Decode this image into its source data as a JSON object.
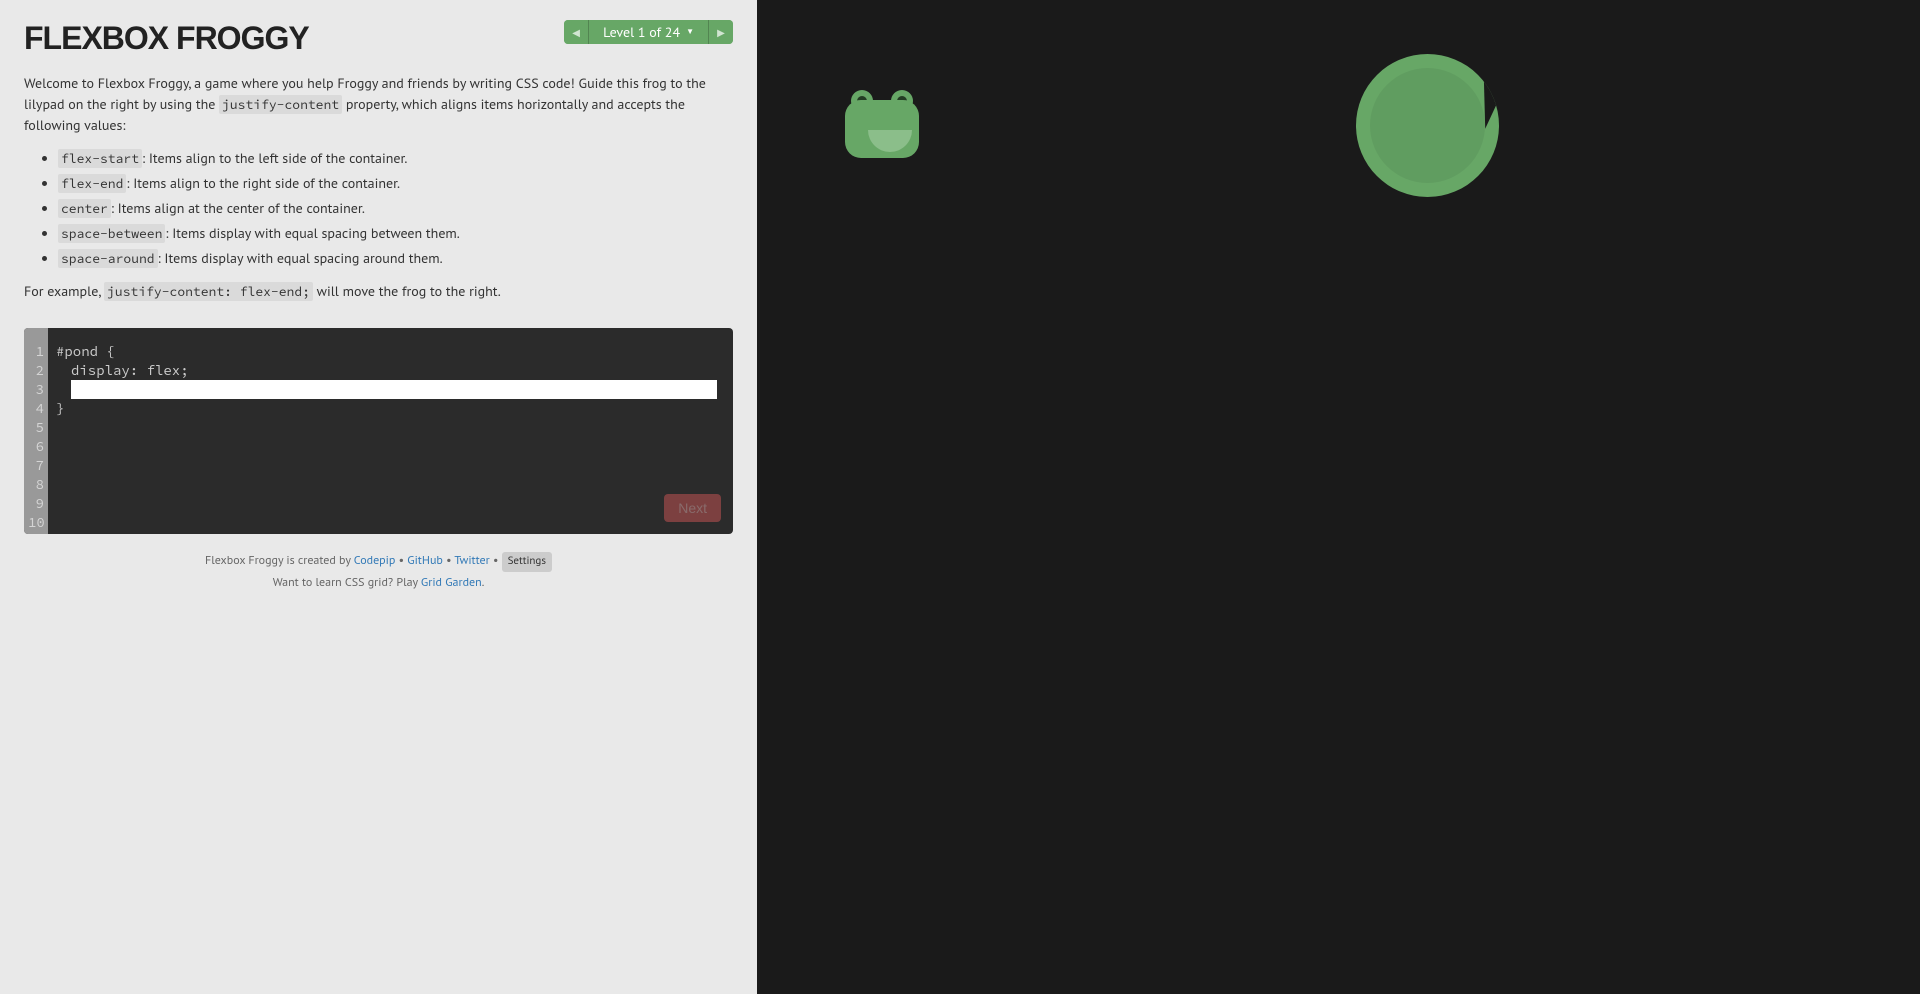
{
  "header": {
    "title": "FLEXBOX FROGGY",
    "level_label": "Level 1 of 24"
  },
  "instructions": {
    "intro_part1": "Welcome to Flexbox Froggy, a game where you help Froggy and friends by writing CSS code! Guide this frog to the lilypad on the right by using the ",
    "intro_code": "justify-content",
    "intro_part2": " property, which aligns items horizontally and accepts the following values:",
    "values": [
      {
        "code": "flex-start",
        "desc": ": Items align to the left side of the container."
      },
      {
        "code": "flex-end",
        "desc": ": Items align to the right side of the container."
      },
      {
        "code": "center",
        "desc": ": Items align at the center of the container."
      },
      {
        "code": "space-between",
        "desc": ": Items display with equal spacing between them."
      },
      {
        "code": "space-around",
        "desc": ": Items display with equal spacing around them."
      }
    ],
    "example_part1": "For example, ",
    "example_code": "justify-content: flex-end;",
    "example_part2": " will move the frog to the right."
  },
  "editor": {
    "line_numbers": [
      "1",
      "2",
      "3",
      "4",
      "5",
      "6",
      "7",
      "8",
      "9",
      "10"
    ],
    "line1": "#pond {",
    "line2": "display: flex;",
    "line4": "}",
    "next_button": "Next"
  },
  "footer": {
    "credit_prefix": "Flexbox Froggy is created by ",
    "codepip": "Codepip",
    "github": "GitHub",
    "twitter": "Twitter",
    "settings": "Settings",
    "learn_prefix": "Want to learn CSS grid? Play ",
    "grid_garden": "Grid Garden",
    "period": "."
  }
}
